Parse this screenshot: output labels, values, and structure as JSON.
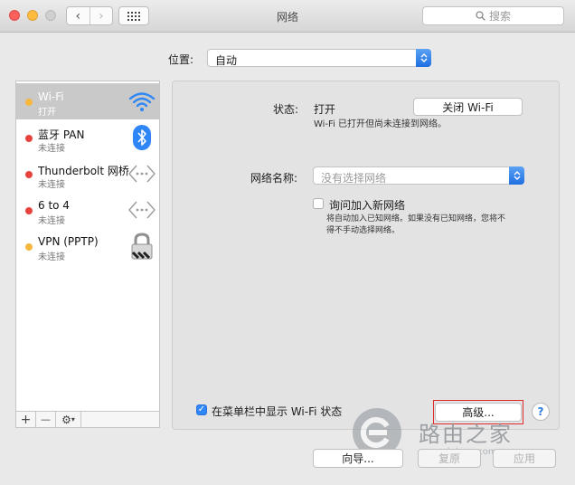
{
  "window": {
    "title": "网络",
    "search_placeholder": "搜索"
  },
  "location": {
    "label": "位置:",
    "value": "自动"
  },
  "services": [
    {
      "name": "Wi-Fi",
      "status": "打开",
      "dot": "#f6b73c",
      "icon": "wifi-icon",
      "selected": true
    },
    {
      "name": "蓝牙 PAN",
      "status": "未连接",
      "dot": "#e8433e",
      "icon": "bluetooth-icon",
      "selected": false
    },
    {
      "name": "Thunderbolt 网桥",
      "status": "未连接",
      "dot": "#e8433e",
      "icon": "thunderbolt-bridge-icon",
      "selected": false
    },
    {
      "name": "6 to 4",
      "status": "未连接",
      "dot": "#e8433e",
      "icon": "6to4-icon",
      "selected": false
    },
    {
      "name": "VPN (PPTP)",
      "status": "未连接",
      "dot": "#f6b73c",
      "icon": "vpn-lock-icon",
      "selected": false
    }
  ],
  "sidebar_tools": {
    "add": "+",
    "remove": "—",
    "gear": "⚙"
  },
  "detail": {
    "status_label": "状态:",
    "status_value": "打开",
    "toggle_button": "关闭 Wi-Fi",
    "status_desc": "Wi-Fi 已打开但尚未连接到网络。",
    "network_name_label": "网络名称:",
    "network_name_placeholder": "没有选择网络",
    "ask_join_label": "询问加入新网络",
    "ask_join_checked": false,
    "ask_join_desc_1": "将自动加入已知网络。如果没有已知网络，您将不",
    "ask_join_desc_2": "得不手动选择网络。",
    "show_menubar_label": "在菜单栏中显示 Wi-Fi 状态",
    "show_menubar_checked": true,
    "advanced_button": "高级...",
    "help": "?"
  },
  "footer": {
    "assist_button": "向导...",
    "revert_button": "复原",
    "apply_button": "应用"
  },
  "watermark": {
    "text": "路由之家",
    "url": "www.lulyou.com"
  }
}
